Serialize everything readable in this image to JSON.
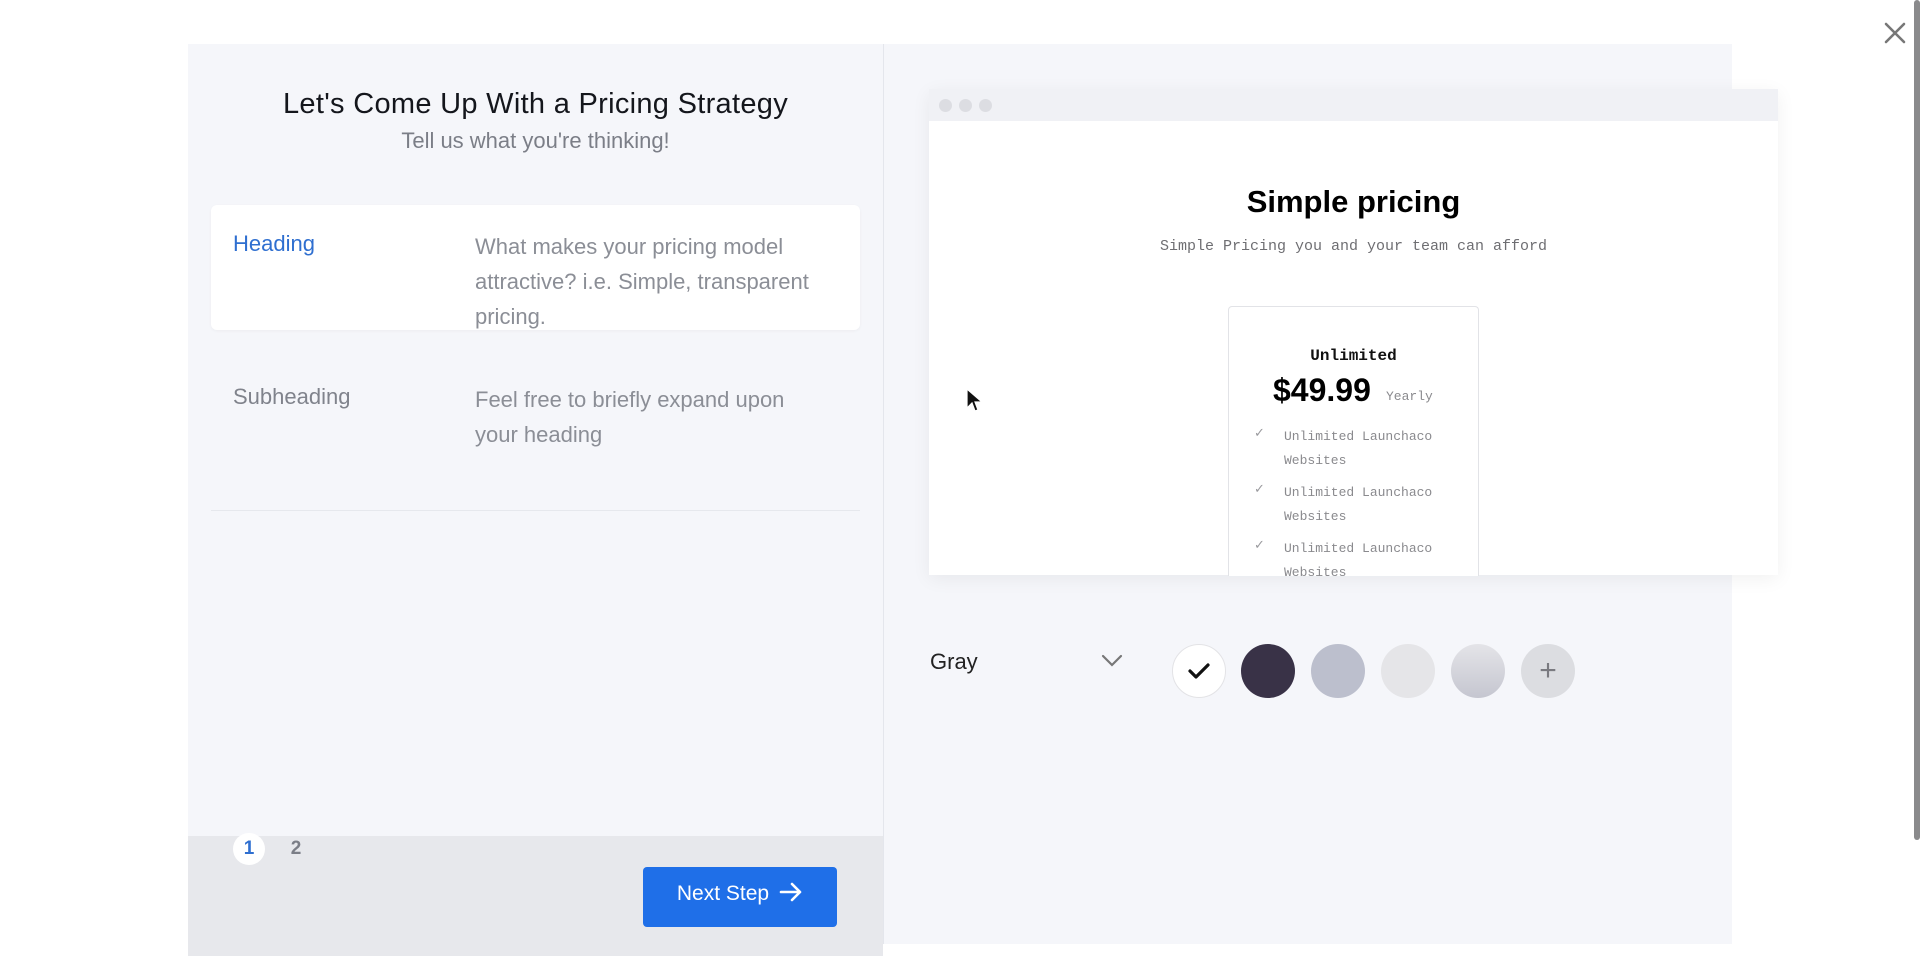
{
  "modal": {
    "title": "Let's Come Up With a Pricing Strategy",
    "subtitle": "Tell us what you're thinking!",
    "fields": [
      {
        "label": "Heading",
        "value": "What makes your pricing model attractive? i.e. Simple, transparent pricing.",
        "active": true
      },
      {
        "label": "Subheading",
        "value": "Feel free to briefly expand upon your heading",
        "active": false
      }
    ],
    "steps": [
      "1",
      "2"
    ],
    "current_step": "1",
    "next_button_label": "Next Step",
    "next_button_icon": "arrow-right-icon",
    "accent_color": "#1f6fe8",
    "close_icon": "close-icon"
  },
  "preview": {
    "window_dots": 3,
    "title": "Simple pricing",
    "subtitle": "Simple Pricing you and your team can afford",
    "plan": {
      "name": "Unlimited",
      "price": "$49.99",
      "period": "Yearly",
      "features": [
        "Unlimited Launchaco Websites",
        "Unlimited Launchaco Websites",
        "Unlimited Launchaco Websites"
      ]
    }
  },
  "color_picker": {
    "selected_label": "Gray",
    "swatches": [
      {
        "name": "white",
        "color": "#ffffff",
        "selected": true
      },
      {
        "name": "dark-purple",
        "color": "#393247",
        "selected": false
      },
      {
        "name": "gray-blue",
        "color": "#bcbfcd",
        "selected": false
      },
      {
        "name": "light-gray",
        "color": "#e5e5e8",
        "selected": false
      },
      {
        "name": "gradient-gray",
        "color": "#d2d3da",
        "selected": false
      }
    ],
    "add_label": "+"
  }
}
